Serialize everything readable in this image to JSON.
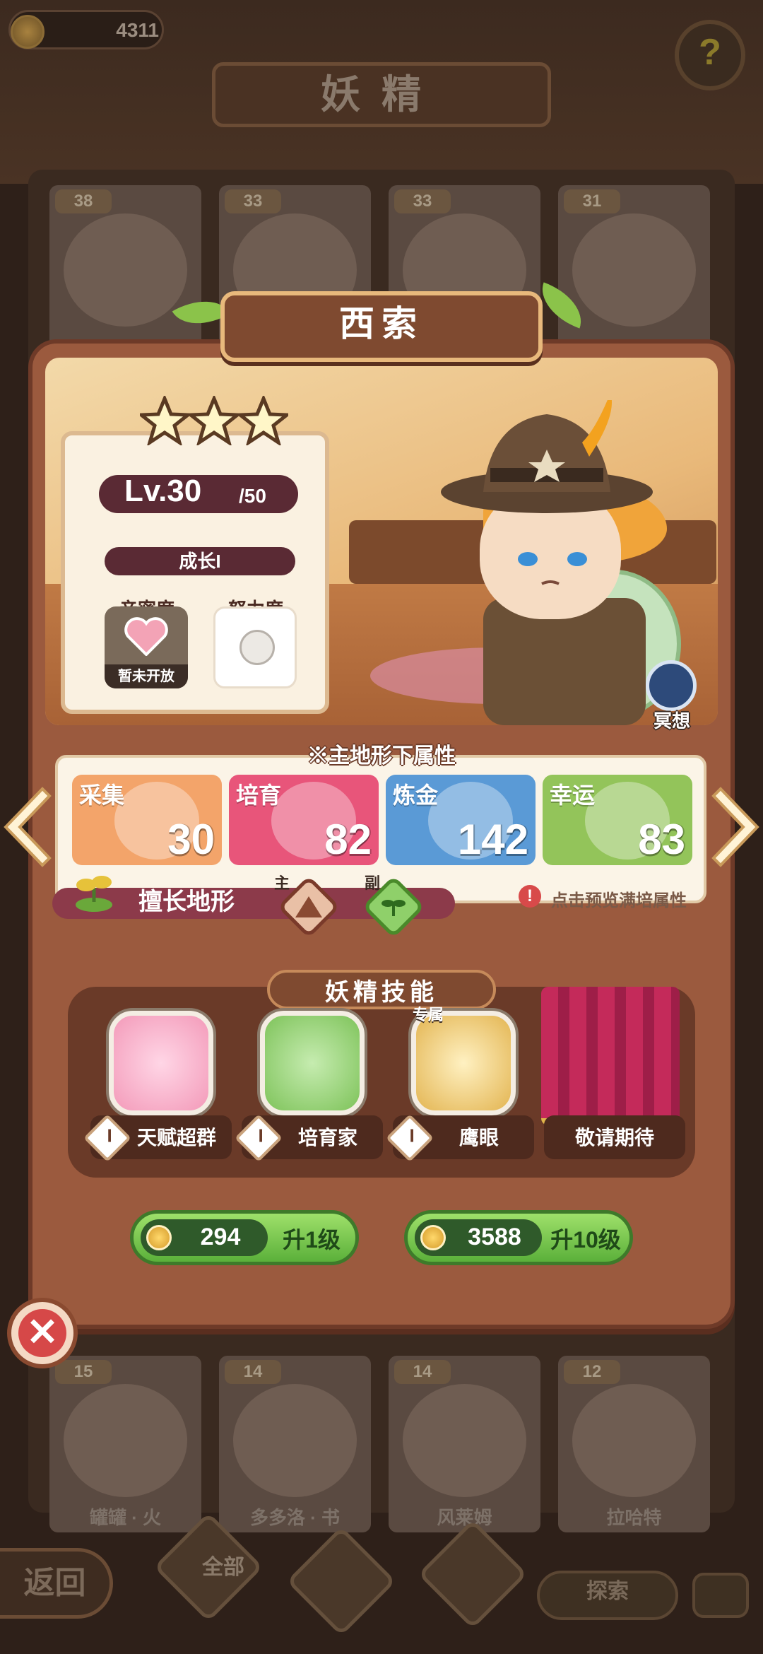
{
  "top_bar": {
    "coins": "4311",
    "help_icon": "question-icon"
  },
  "background": {
    "title": "妖精",
    "cards_top": [
      {
        "level": "38"
      },
      {
        "level": "33"
      },
      {
        "level": "33"
      },
      {
        "level": "31"
      }
    ],
    "cards_bottom": [
      {
        "level": "15",
        "name": "罐罐 · 火"
      },
      {
        "level": "14",
        "name": "多多洛 · 书"
      },
      {
        "level": "14",
        "name": "风莱姆"
      },
      {
        "level": "12",
        "name": "拉哈特"
      }
    ],
    "nav": {
      "back": "返回",
      "all": "全部",
      "explore": "探索"
    }
  },
  "fairy": {
    "name": "西索",
    "stars": 3,
    "level": "Lv.30",
    "level_max": "/50",
    "growth": "成长I",
    "intimacy_label": "亲密度",
    "intimacy_status": "暂未开放",
    "effort_label": "努力度",
    "meditate": "冥想"
  },
  "attributes": {
    "title": "※主地形下属性",
    "items": [
      {
        "name": "采集",
        "value": "30",
        "color": "#f3a46a"
      },
      {
        "name": "培育",
        "value": "82",
        "color": "#e8557a"
      },
      {
        "name": "炼金",
        "value": "142",
        "color": "#5a9ad6"
      },
      {
        "name": "幸运",
        "value": "83",
        "color": "#93c45a"
      }
    ],
    "terrain_label": "擅长地形",
    "terrain_main": "主",
    "terrain_sub": "副",
    "preview_hint": "点击预览满培属性"
  },
  "skills": {
    "title": "妖精技能",
    "items": [
      {
        "name": "天赋超群",
        "level": "I",
        "icon": "octopus-icon"
      },
      {
        "name": "培育家",
        "level": "I",
        "icon": "watering-can-icon"
      },
      {
        "name": "鹰眼",
        "level": "I",
        "icon": "bee-icon",
        "badge": "专属"
      }
    ],
    "coming_soon": "敬请期待"
  },
  "upgrades": [
    {
      "cost": "294",
      "label": "升1级"
    },
    {
      "cost": "3588",
      "label": "升10级"
    }
  ]
}
